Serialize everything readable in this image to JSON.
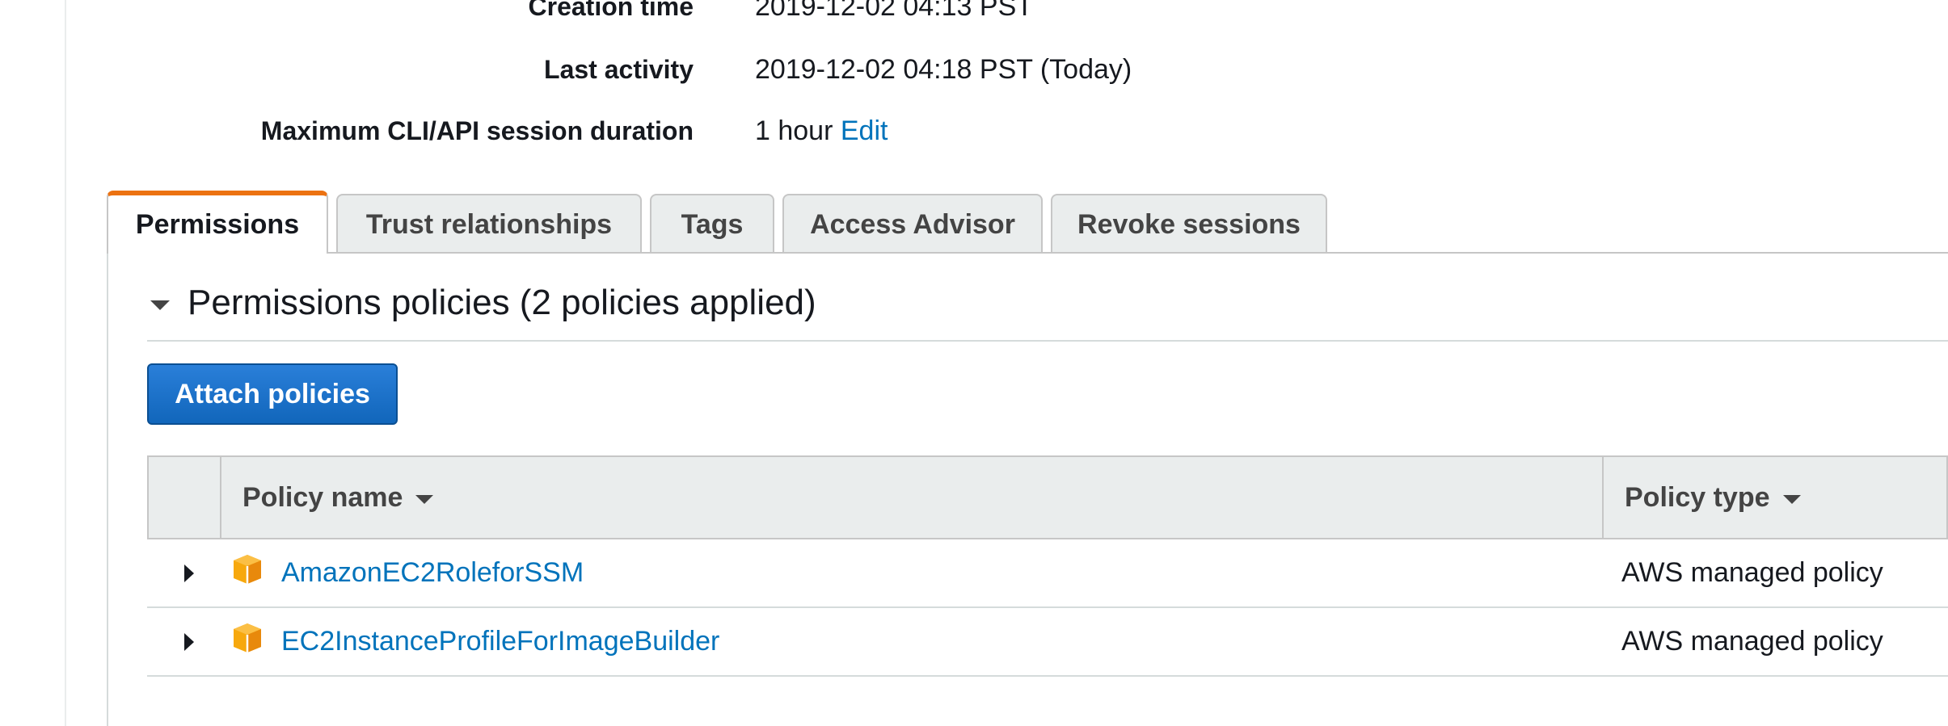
{
  "summary": {
    "creation_time_label": "Creation time",
    "creation_time_value": "2019-12-02 04:13 PST",
    "last_activity_label": "Last activity",
    "last_activity_value": "2019-12-02 04:18 PST (Today)",
    "max_session_label": "Maximum CLI/API session duration",
    "max_session_value": "1 hour",
    "max_session_edit": "Edit"
  },
  "tabs": [
    {
      "label": "Permissions",
      "active": true
    },
    {
      "label": "Trust relationships",
      "active": false
    },
    {
      "label": "Tags",
      "active": false
    },
    {
      "label": "Access Advisor",
      "active": false
    },
    {
      "label": "Revoke sessions",
      "active": false
    }
  ],
  "permissions": {
    "section_title": "Permissions policies (2 policies applied)",
    "attach_button": "Attach policies",
    "table": {
      "columns": [
        "Policy name",
        "Policy type"
      ],
      "rows": [
        {
          "name": "AmazonEC2RoleforSSM",
          "type": "AWS managed policy",
          "icon": "aws-managed-policy-cube-icon"
        },
        {
          "name": "EC2InstanceProfileForImageBuilder",
          "type": "AWS managed policy",
          "icon": "aws-managed-policy-cube-icon"
        }
      ]
    }
  },
  "colors": {
    "link": "#0073bb",
    "active_tab_accent": "#ec7211",
    "primary_button": "#1166bb",
    "policy_icon": "#f7a80d"
  }
}
